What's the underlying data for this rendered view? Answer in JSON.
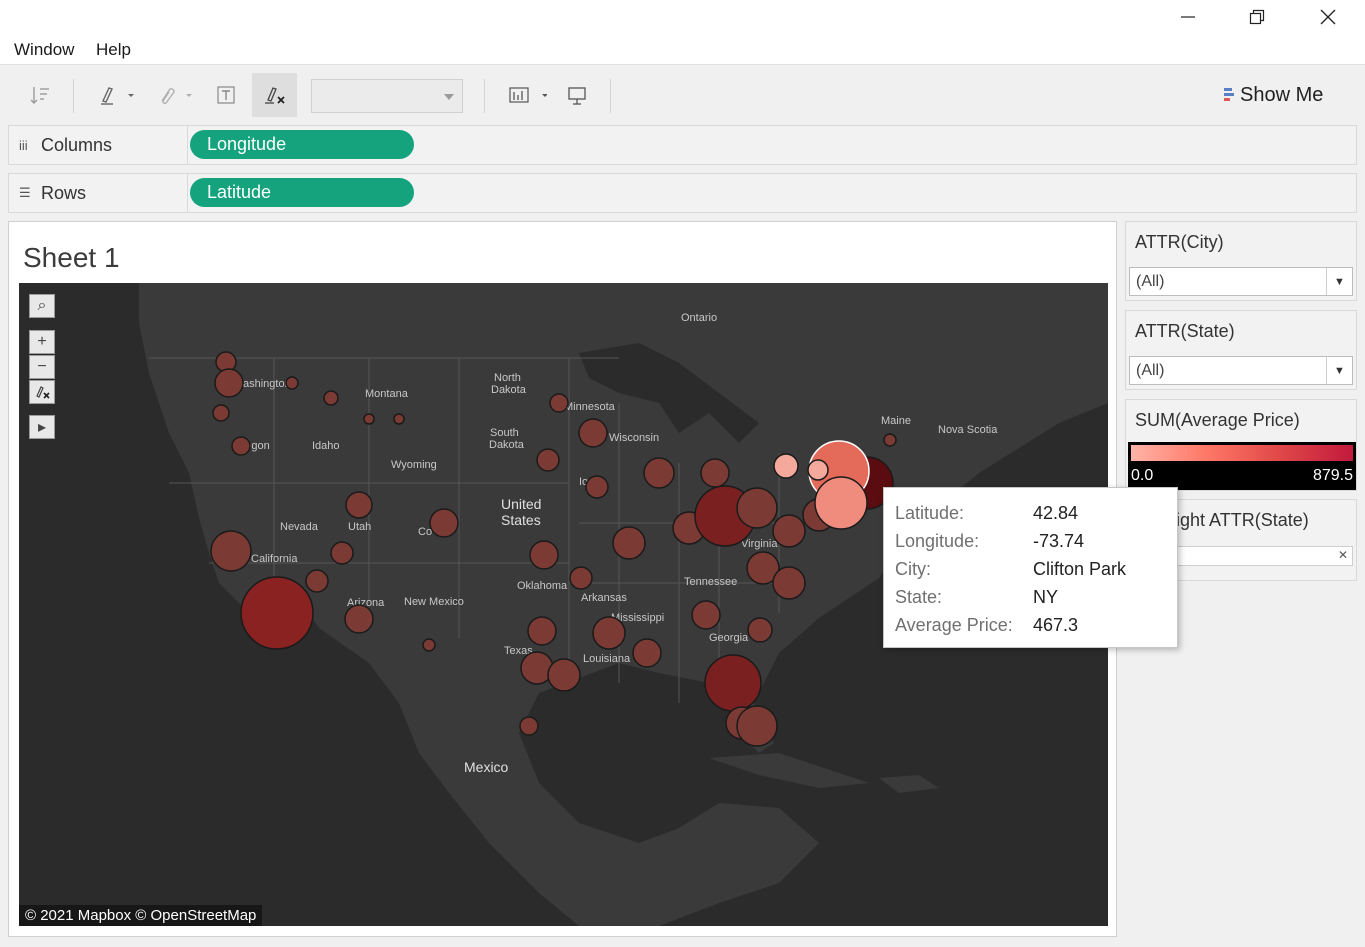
{
  "window_controls": {
    "minimize": "minimize-icon",
    "restore": "restore-icon",
    "close": "close-icon"
  },
  "menu": {
    "window": "Window",
    "help": "Help"
  },
  "toolbar": {
    "show_me": "Show Me",
    "dropdown_value": ""
  },
  "shelves": {
    "columns": {
      "label": "Columns",
      "pill": "Longitude"
    },
    "rows": {
      "label": "Rows",
      "pill": "Latitude"
    }
  },
  "sheet": {
    "title": "Sheet 1"
  },
  "map": {
    "attribution": "© 2021 Mapbox © OpenStreetMap",
    "labels": [
      "Ontario",
      "Montana",
      "North Dakota",
      "South Dakota",
      "Wyoming",
      "Idaho",
      "Nevada",
      "Utah",
      "Colorado",
      "New Mexico",
      "Arizona",
      "California",
      "Oregon",
      "Washington",
      "Minnesota",
      "Wisconsin",
      "Iowa",
      "United States",
      "Oklahoma",
      "Arkansas",
      "Mississippi",
      "Louisiana",
      "Texas",
      "Georgia",
      "Tennessee",
      "Virginia",
      "Maine",
      "Nova Scotia",
      "Mexico"
    ]
  },
  "tooltip": {
    "rows": [
      {
        "label": "Latitude:",
        "value": "42.84"
      },
      {
        "label": "Longitude:",
        "value": "-73.74"
      },
      {
        "label": "City:",
        "value": "Clifton Park"
      },
      {
        "label": "State:",
        "value": "NY"
      },
      {
        "label": "Average Price:",
        "value": "467.3"
      }
    ]
  },
  "filters": {
    "city": {
      "title": "ATTR(City)",
      "value": "(All)"
    },
    "state": {
      "title": "ATTR(State)",
      "value": "(All)"
    },
    "legend": {
      "title": "SUM(Average Price)",
      "min": "0.0",
      "max": "879.5"
    },
    "highlight": {
      "title": "Highlight ATTR(State)"
    }
  },
  "colors": {
    "pill": "#14a37d",
    "map_bg": "#2b2b2b",
    "mark_low": "#ffb3a7",
    "mark_high": "#c11a3c"
  }
}
